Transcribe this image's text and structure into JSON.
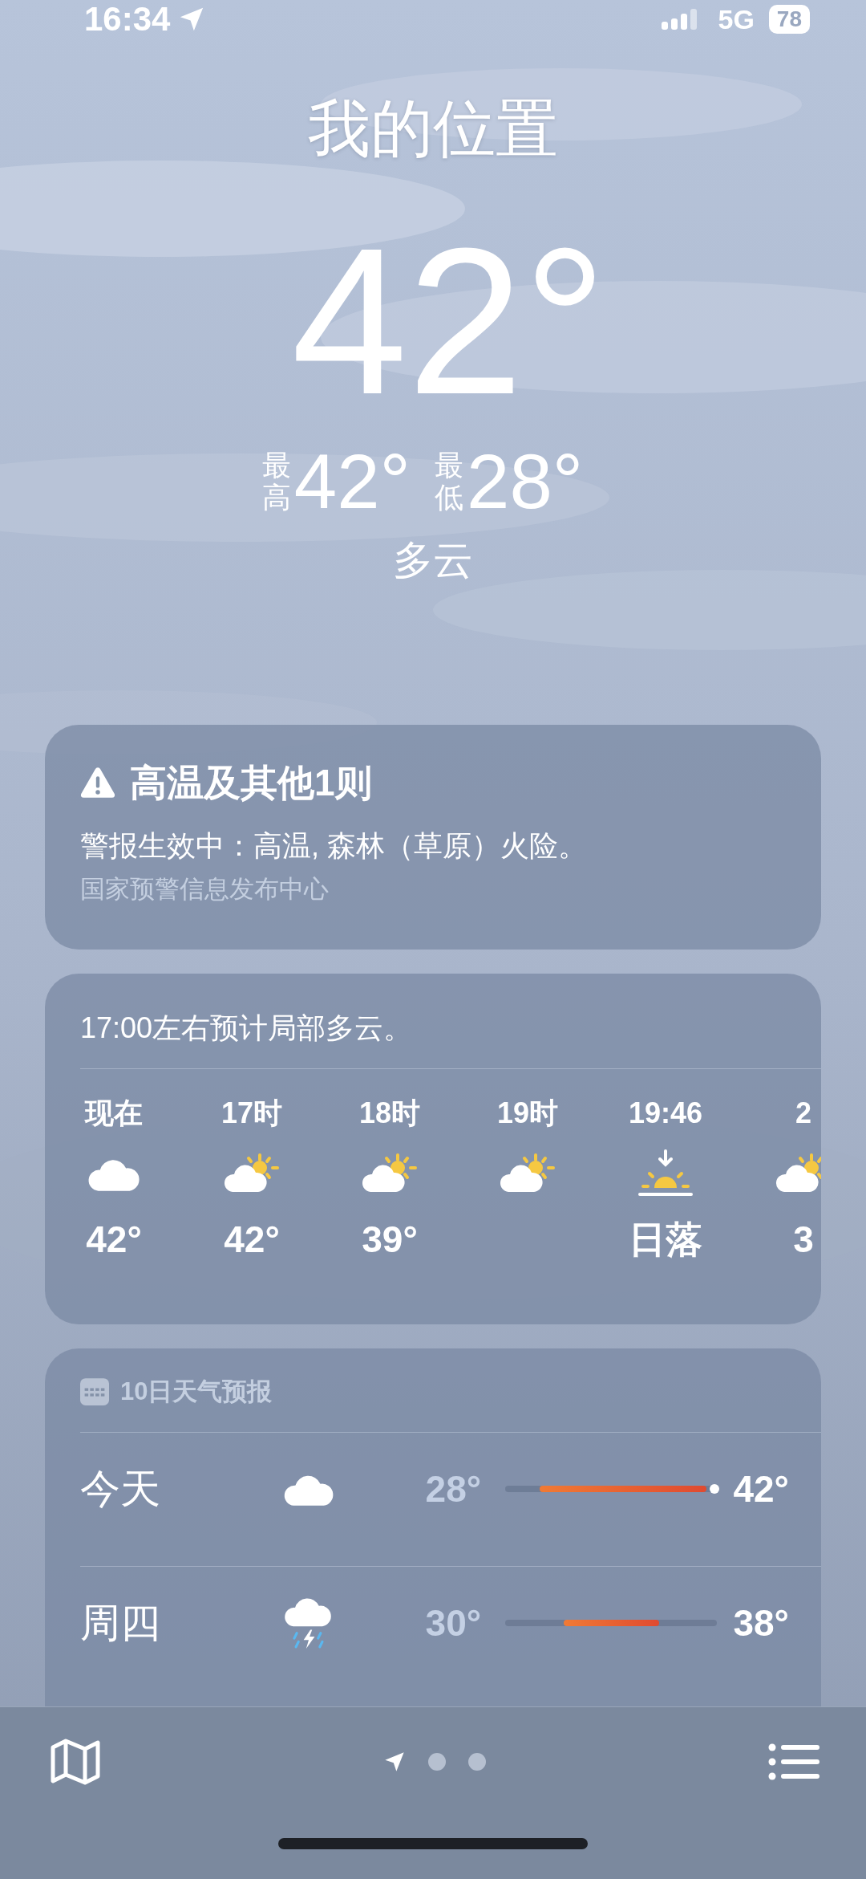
{
  "status_bar": {
    "time": "16:34",
    "network": "5G",
    "battery": "78"
  },
  "location": {
    "title": "我的位置",
    "temperature": "42°",
    "high_label": "最高",
    "high": "42°",
    "low_label": "最低",
    "low": "28°",
    "condition": "多云"
  },
  "alert": {
    "title": "高温及其他1则",
    "body": "警报生效中：高温, 森林（草原）火险。",
    "source": "国家预警信息发布中心"
  },
  "hourly": {
    "summary": "17:00左右预计局部多云。",
    "hours": [
      {
        "time": "现在",
        "kind": "cloud",
        "temp": "42°"
      },
      {
        "time": "17时",
        "kind": "partly",
        "temp": "42°"
      },
      {
        "time": "18时",
        "kind": "partly",
        "temp": "39°"
      },
      {
        "time": "19时",
        "kind": "partly"
      },
      {
        "time": "19:46",
        "kind": "sunset",
        "temp": "日落"
      },
      {
        "time": "2",
        "kind": "partly",
        "temp": "3"
      }
    ]
  },
  "forecast": {
    "title": "10日天气预报",
    "days": [
      {
        "day": "今天",
        "kind": "cloud",
        "low": "28°",
        "high": "42°",
        "now_marker": true
      },
      {
        "day": "周四",
        "kind": "thunder",
        "low": "30°",
        "high": "38°",
        "now_marker": false
      }
    ]
  },
  "pages": [
    {
      "kind": "location",
      "selected": true
    },
    {
      "kind": "dot",
      "selected": false
    },
    {
      "kind": "dot",
      "selected": false
    }
  ]
}
